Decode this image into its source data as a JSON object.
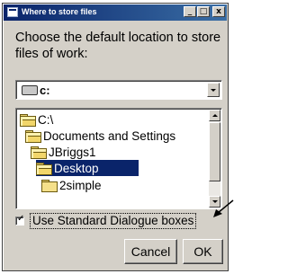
{
  "window": {
    "title": "Where to store files",
    "controls": {
      "minimize": "_",
      "maximize": "□",
      "close": "x"
    }
  },
  "prompt": "Choose the default location to store files of work:",
  "drive_select": {
    "value": "c:"
  },
  "folder_tree": {
    "items": [
      {
        "label": "C:\\",
        "selected": false
      },
      {
        "label": "Documents and Settings",
        "selected": false
      },
      {
        "label": "JBriggs1",
        "selected": false
      },
      {
        "label": "Desktop",
        "selected": true
      },
      {
        "label": "2simple",
        "selected": false
      }
    ]
  },
  "use_standard_dialogue": {
    "label": "Use Standard Dialogue boxes",
    "checked": true,
    "mark": "✓"
  },
  "buttons": {
    "cancel": "Cancel",
    "ok": "OK"
  },
  "colors": {
    "selection": "#0a246a",
    "window": "#d4d0c8",
    "annotation_arrow": "#000000"
  }
}
